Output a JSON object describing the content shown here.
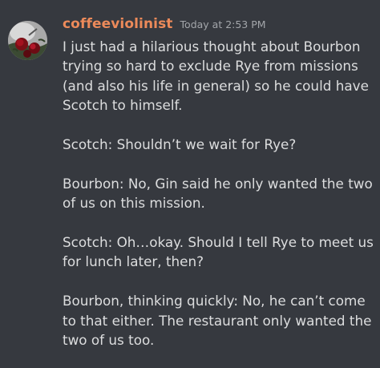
{
  "message": {
    "author": {
      "username": "coffeeviolinist",
      "avatar_icon": "rose-avatar-icon",
      "name_color": "#ec8a5a"
    },
    "timestamp": "Today at 2:53 PM",
    "paragraphs": [
      "I just had a hilarious thought about Bourbon\ntrying so hard to exclude Rye from missions\n(and also his life in general) so he could have\nScotch to himself.",
      "Scotch: Shouldn’t we wait for Rye?",
      "Bourbon: No, Gin said he only wanted the two\nof us on this mission.",
      "Scotch: Oh…okay. Should I tell Rye to meet us\nfor lunch later, then?",
      "Bourbon, thinking quickly: No, he can’t come\nto that either. The restaurant only wanted the\ntwo of us too."
    ]
  },
  "theme": {
    "background": "#36393f",
    "text": "#dcddde",
    "muted": "#a3a6aa"
  }
}
